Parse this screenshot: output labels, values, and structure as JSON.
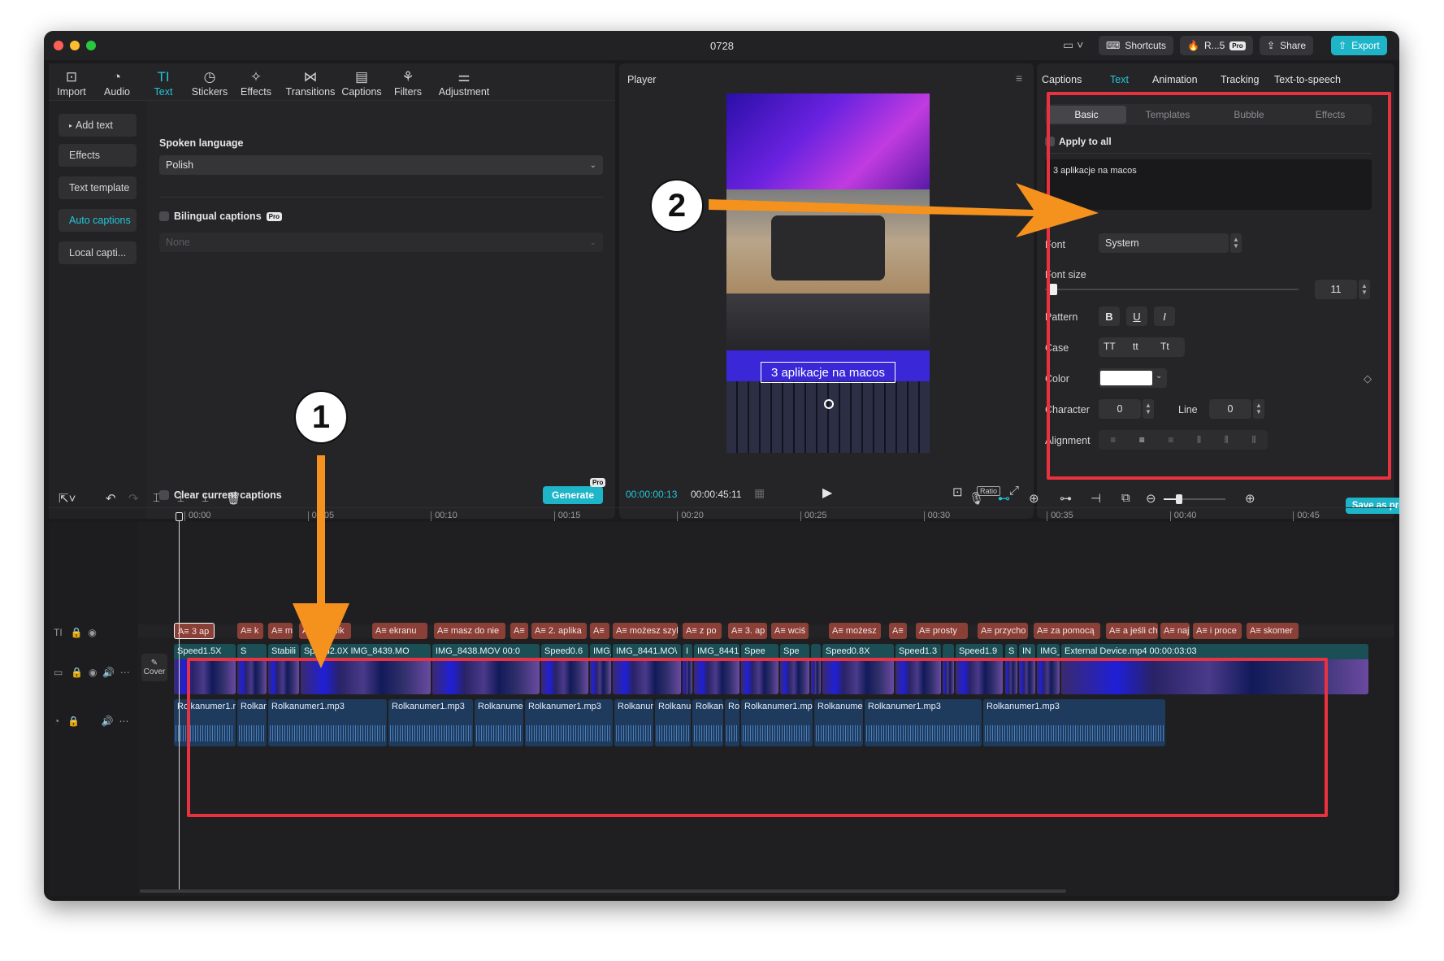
{
  "window": {
    "title": "0728",
    "top_buttons": {
      "shortcuts": "Shortcuts",
      "account": "R...5",
      "pro": "Pro",
      "share": "Share",
      "export": "Export"
    }
  },
  "toolbar": {
    "items": [
      {
        "label": "Import",
        "icon": "import-icon"
      },
      {
        "label": "Audio",
        "icon": "audio-icon"
      },
      {
        "label": "Text",
        "icon": "text-icon"
      },
      {
        "label": "Stickers",
        "icon": "stickers-icon"
      },
      {
        "label": "Effects",
        "icon": "effects-icon"
      },
      {
        "label": "Transitions",
        "icon": "transitions-icon"
      },
      {
        "label": "Captions",
        "icon": "captions-icon"
      },
      {
        "label": "Filters",
        "icon": "filters-icon"
      },
      {
        "label": "Adjustment",
        "icon": "adjustment-icon"
      }
    ],
    "active": "Text"
  },
  "text_sidebar": {
    "items": [
      "Add text",
      "Effects",
      "Text template",
      "Auto captions",
      "Local capti..."
    ],
    "active": "Auto captions"
  },
  "auto_captions": {
    "spoken_language_label": "Spoken language",
    "spoken_language_value": "Polish",
    "bilingual_label": "Bilingual captions",
    "bilingual_badge": "Pro",
    "bilingual_value": "None",
    "clear_label": "Clear current captions",
    "generate_label": "Generate",
    "generate_badge": "Pro"
  },
  "player": {
    "title": "Player",
    "caption_overlay": "3 aplikacje na macos",
    "current_time": "00:00:00:13",
    "total_time": "00:00:45:11",
    "ratio_label": "Ratio"
  },
  "inspector": {
    "tabs": [
      "Captions",
      "Text",
      "Animation",
      "Tracking",
      "Text-to-speech"
    ],
    "active_tab": "Text",
    "subtabs": [
      "Basic",
      "Templates",
      "Bubble",
      "Effects"
    ],
    "active_subtab": "Basic",
    "apply_to_all": "Apply to all",
    "text_content": "3 aplikacje na macos",
    "font_label": "Font",
    "font_value": "System",
    "font_size_label": "Font size",
    "font_size_value": "11",
    "pattern_label": "Pattern",
    "pattern_buttons": [
      "B",
      "U",
      "I"
    ],
    "case_label": "Case",
    "case_buttons": [
      "TT",
      "tt",
      "Tt"
    ],
    "color_label": "Color",
    "color_value": "#ffffff",
    "character_label": "Character",
    "character_value": "0",
    "line_label": "Line",
    "line_value": "0",
    "alignment_label": "Alignment",
    "save_preset": "Save as preset"
  },
  "timeline": {
    "ticks": [
      "00:00",
      "00:05",
      "00:10",
      "00:15",
      "00:20",
      "00:25",
      "00:30",
      "00:35",
      "00:40",
      "00:45"
    ],
    "caption_clips": [
      "3 ap",
      "k",
      "m",
      "ta aplik",
      "ekranu",
      "masz do nie",
      "",
      "2. aplika",
      "",
      "możesz szyb",
      "z po",
      "3. ap",
      "wciś",
      "możesz",
      "",
      "prosty",
      "przycho",
      "za pomocą",
      "a jeśli ch",
      "naj",
      "i proce",
      "skomer"
    ],
    "video_clips": [
      "Speed1.5X",
      "S",
      "Stabili",
      "Speed2.0X  IMG_8439.MO",
      "IMG_8438.MOV  00:0",
      "Speed0.6",
      "IMG_",
      "IMG_8441.MO\\",
      "I",
      "IMG_8441",
      "Spee",
      "Spe",
      "",
      "Speed0.8X",
      "Speed1.3",
      "",
      "Speed1.9",
      "S",
      "IN",
      "IMG_",
      "External Device.mp4  00:00:03:03"
    ],
    "audio_clips": [
      "Rolkanumer1.mp3",
      "Rolkan",
      "Rolkanumer1.mp3",
      "Rolkanumer1.mp3",
      "Rolkanumer1",
      "Rolkanumer1.mp3",
      "Rolkanum",
      "Rolkanun",
      "Rolkanu",
      "Rol",
      "Rolkanumer1.mp3",
      "Rolkanumer1.",
      "Rolkanumer1.mp3",
      "Rolkanumer1.mp3"
    ],
    "cover_label": "Cover"
  },
  "annotations": {
    "marker1": "1",
    "marker2": "2"
  },
  "colors": {
    "accent": "#22c7d9",
    "highlight": "#e8323f",
    "arrow": "#f5921e"
  }
}
